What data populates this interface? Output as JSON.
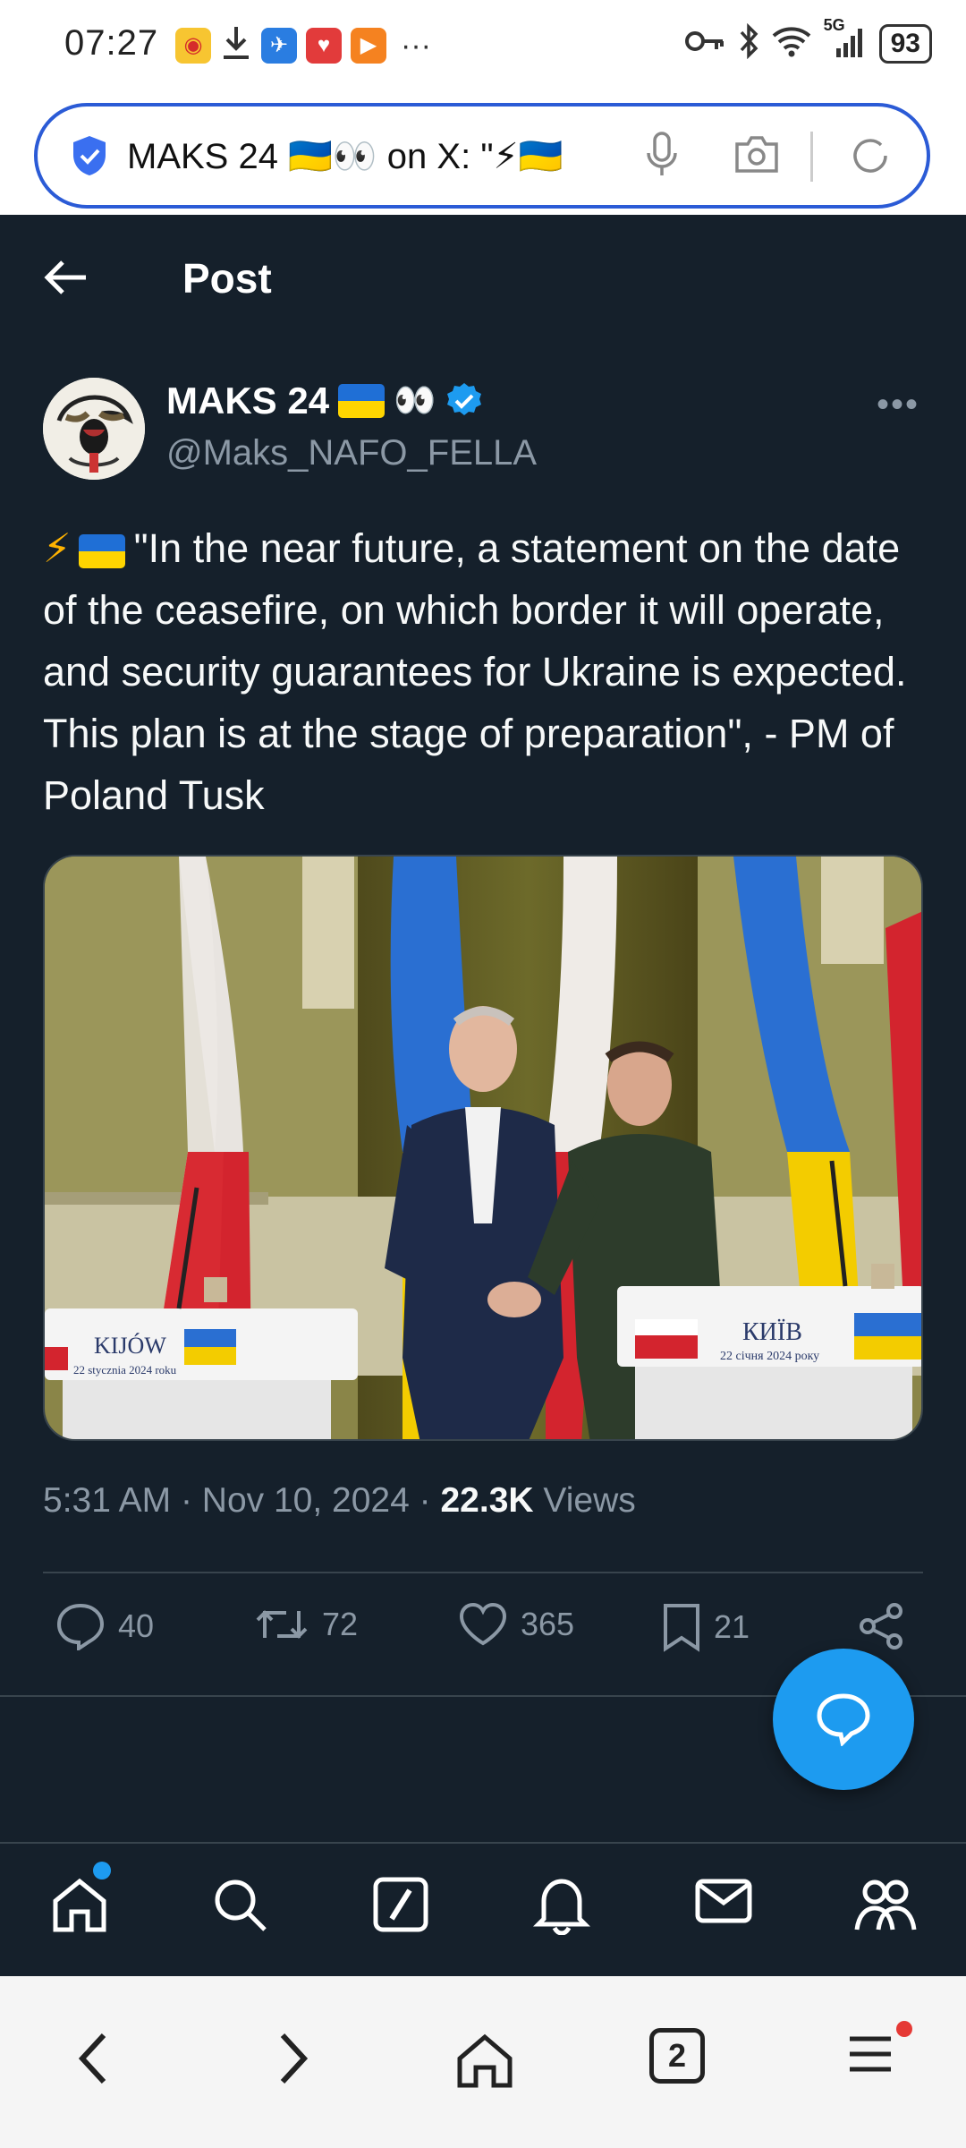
{
  "status_bar": {
    "time": "07:27",
    "network": "5G",
    "battery": "93",
    "overflow": "···"
  },
  "browser": {
    "address_text": "MAKS 24 🇺🇦👀 on X: \"⚡🇺🇦",
    "tab_count": "2"
  },
  "header": {
    "title": "Post"
  },
  "tweet": {
    "display_name": "MAKS 24",
    "handle": "@Maks_NAFO_FELLA",
    "text_prefix": "⚡",
    "text": "\"In the near future, a statement on the date of the ceasefire, on which border it will operate, and security guarantees for Ukraine is expected. This plan is at the stage of preparation\", - PM of Poland Tusk",
    "media": {
      "left_podium_city": "KIJÓW",
      "left_podium_date": "22 stycznia 2024 roku",
      "right_podium_city": "КИЇВ",
      "right_podium_date": "22 січня 2024 року"
    },
    "time": "5:31 AM",
    "date": "Nov 10, 2024",
    "views_count": "22.3K",
    "views_label": "Views",
    "separator": "·",
    "stats": {
      "replies": "40",
      "reposts": "72",
      "likes": "365",
      "bookmarks": "21"
    }
  },
  "colors": {
    "background": "#15202b",
    "accent": "#1d9bf0",
    "muted_text": "#8b98a5",
    "divider": "#38444d"
  },
  "icons": [
    "back-arrow-icon",
    "verified-badge-icon",
    "more-icon",
    "reply-icon",
    "repost-icon",
    "like-icon",
    "bookmark-icon",
    "share-icon",
    "compose-icon",
    "home-icon",
    "search-icon",
    "grok-icon",
    "notifications-icon",
    "messages-icon",
    "communities-icon"
  ]
}
